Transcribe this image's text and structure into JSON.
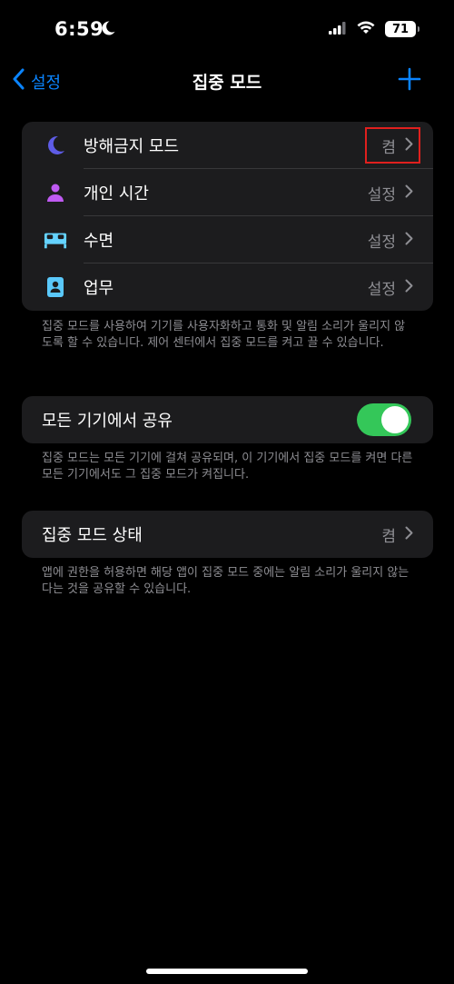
{
  "status_bar": {
    "time": "6:59",
    "battery": "71"
  },
  "nav": {
    "back_label": "설정",
    "title": "집중 모드"
  },
  "focus_modes": [
    {
      "label": "방해금지 모드",
      "value": "켬",
      "icon": "moon-icon",
      "color": "#5e5ce6"
    },
    {
      "label": "개인 시간",
      "value": "설정",
      "icon": "person-icon",
      "color": "#bf5af2"
    },
    {
      "label": "수면",
      "value": "설정",
      "icon": "bed-icon",
      "color": "#64d2ff"
    },
    {
      "label": "업무",
      "value": "설정",
      "icon": "id-badge-icon",
      "color": "#5ac8fa"
    }
  ],
  "focus_footnote": "집중 모드를 사용하여 기기를 사용자화하고 통화 및 알림 소리가 울리지 않도록 할 수 있습니다. 제어 센터에서 집중 모드를 켜고 끌 수 있습니다.",
  "share": {
    "label": "모든 기기에서 공유",
    "enabled": true
  },
  "share_footnote": "집중 모드는 모든 기기에 걸쳐 공유되며, 이 기기에서 집중 모드를 켜면 다른 모든 기기에서도 그 집중 모드가 켜집니다.",
  "status": {
    "label": "집중 모드 상태",
    "value": "켬"
  },
  "status_footnote": "앱에 권한을 허용하면 해당 앱이 집중 모드 중에는 알림 소리가 울리지 않는다는 것을 공유할 수 있습니다.",
  "colors": {
    "accent": "#0a84ff",
    "toggle_on": "#34c759",
    "highlight": "#e0201e"
  }
}
